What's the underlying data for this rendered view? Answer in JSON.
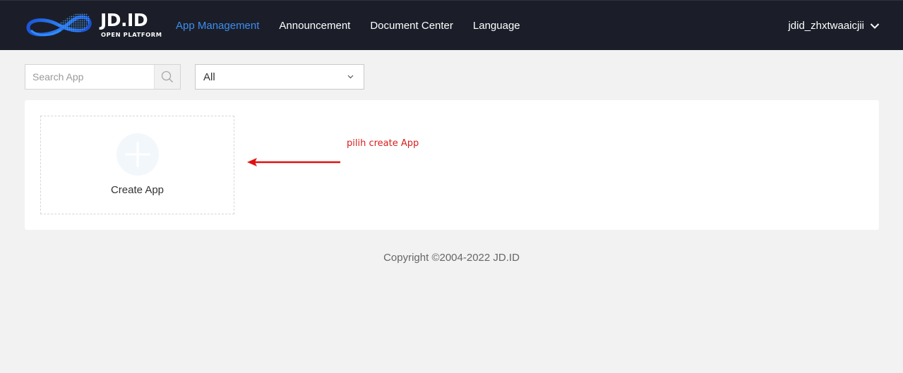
{
  "header": {
    "logo": {
      "title": "JD.ID",
      "subtitle": "OPEN PLATFORM"
    },
    "nav": [
      {
        "label": "App Management",
        "active": true
      },
      {
        "label": "Announcement",
        "active": false
      },
      {
        "label": "Document Center",
        "active": false
      },
      {
        "label": "Language",
        "active": false
      }
    ],
    "user": {
      "name": "jdid_zhxtwaaicjii",
      "icon": "chevron-down-icon"
    }
  },
  "toolbar": {
    "search": {
      "placeholder": "Search App",
      "value": "",
      "icon": "search-icon"
    },
    "filter": {
      "selected": "All",
      "icon": "chevron-down-icon"
    }
  },
  "main": {
    "create_app": {
      "label": "Create App",
      "icon": "plus-icon"
    }
  },
  "annotation": {
    "text": "pilih create App",
    "color": "#d81e1e",
    "icon": "arrow-left-icon"
  },
  "footer": {
    "copyright": "Copyright ©2004-2022 JD.ID"
  },
  "colors": {
    "header_bg": "#1b1e28",
    "accent": "#3d8ef0",
    "page_bg": "#f2f2f2"
  }
}
